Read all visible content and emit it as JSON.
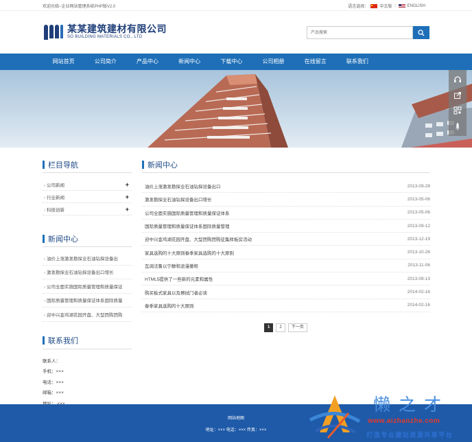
{
  "topbar": {
    "welcome": "欢迎光临~企业网站管理系统PHP版V2.0",
    "lang_label": "语言选择：",
    "lang_cn": "中文版",
    "lang_sep": "::",
    "lang_en": "ENGLISH"
  },
  "header": {
    "company_cn": "某某建筑建材有限公司",
    "company_en": "SO BUILDING MATERIALS CO., LTD",
    "search_placeholder": "产品搜索"
  },
  "nav": {
    "items": [
      {
        "label": "网站首页"
      },
      {
        "label": "公司简介"
      },
      {
        "label": "产品中心"
      },
      {
        "label": "新闻中心"
      },
      {
        "label": "下载中心"
      },
      {
        "label": "公司相册"
      },
      {
        "label": "在线留言"
      },
      {
        "label": "联系我们"
      }
    ]
  },
  "left": {
    "category_title": "栏目导航",
    "categories": [
      {
        "label": "公司新闻",
        "toggle": "+"
      },
      {
        "label": "行业新闻",
        "toggle": "+"
      },
      {
        "label": "科技创新",
        "toggle": "+"
      }
    ],
    "news_title": "新闻中心",
    "news": [
      {
        "label": "油价上涨激发勘探业石油钻探设备出"
      },
      {
        "label": "激发勘探业石油钻探设备出口增长"
      },
      {
        "label": "公司全面实施国际质量管理和质量保证"
      },
      {
        "label": "国际质量管理和质量保证体系国际质量"
      },
      {
        "label": "迎中兴金鸡湖花园开盘、大型团购团购"
      }
    ],
    "contact_title": "联系我们",
    "contact": [
      {
        "label": "联系人："
      },
      {
        "label": "手机：×××"
      },
      {
        "label": "电话：×××"
      },
      {
        "label": "邮箱：×××"
      },
      {
        "label": "地址： ×××"
      }
    ]
  },
  "main": {
    "title": "新闻中心",
    "news": [
      {
        "title": "油价上涨激发勘探业石油钻探设备出口",
        "date": "2013-09-28"
      },
      {
        "title": "激发勘探业石油钻探设备出口增长",
        "date": "2013-05-06"
      },
      {
        "title": "公司全面实施国际质量管理和质量保证体系",
        "date": "2013-05-06"
      },
      {
        "title": "国际质量管理和质量保证体系国际质量管理",
        "date": "2013-09-12"
      },
      {
        "title": "迎中兴金鸡湖花园开盘、大型团购团购征集样板房活动",
        "date": "2013-12-19"
      },
      {
        "title": "家具选购的十大原则春季家具选购的十大原则",
        "date": "2013-10-26"
      },
      {
        "title": "瓦阔法鲁以宁静和浪漫著称",
        "date": "2013-11-06"
      },
      {
        "title": "HTML5提供了一些新的元素和属性",
        "date": "2013-09-13"
      },
      {
        "title": "购买板式家具以及擦拭门者必读",
        "date": "2014-02-16"
      },
      {
        "title": "春季家具选购的十大原则",
        "date": "2014-02-16"
      }
    ],
    "pager": {
      "pages": [
        "1",
        "2"
      ],
      "next": "下一页"
    }
  },
  "footer": {
    "links": "网站地图",
    "contact": "地址：××× 电话：××× 传真：×××"
  },
  "watermark": {
    "title": "懒之才",
    "url": "www.aizhanzhe.com",
    "slogan": "打造专业建站资源共享平台"
  },
  "colors": {
    "brand_blue": "#1e6fb8",
    "footer_blue": "#1e5aa8",
    "logo_navy": "#1f3f7a"
  },
  "icons": [
    "search-icon",
    "headset-icon",
    "share-icon",
    "qrcode-icon",
    "rocket-icon",
    "flag-cn-icon",
    "flag-us-icon"
  ]
}
